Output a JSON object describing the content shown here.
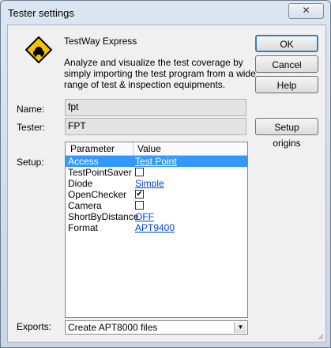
{
  "window": {
    "title": "Tester settings",
    "close_glyph": "✕"
  },
  "product": {
    "icon": "road-sign-car-icon",
    "name": "TestWay Express",
    "description": "Analyze and visualize the test coverage by simply importing the test program from a wide range of test & inspection equipments."
  },
  "labels": {
    "name": "Name:",
    "tester": "Tester:",
    "setup": "Setup:",
    "exports": "Exports:"
  },
  "fields": {
    "name": "fpt",
    "tester": "FPT"
  },
  "buttons": {
    "ok": "OK",
    "cancel": "Cancel",
    "help": "Help",
    "setup_origins": "Setup origins"
  },
  "setup": {
    "columns": [
      "Parameter",
      "Value"
    ],
    "rows": [
      {
        "name": "Access",
        "value": "Test Point",
        "selected": true
      },
      {
        "name": "TestPointSaver",
        "checkbox": false
      },
      {
        "name": "Diode",
        "value": "Simple"
      },
      {
        "name": "OpenChecker",
        "checkbox": true
      },
      {
        "name": "Camera",
        "checkbox": false
      },
      {
        "name": "ShortByDistance",
        "value": "OFF"
      },
      {
        "name": "Format",
        "value": "APT9400"
      }
    ]
  },
  "exports": {
    "selected": "Create APT8000 files",
    "arrow": "▼"
  },
  "check_glyph": "✔"
}
